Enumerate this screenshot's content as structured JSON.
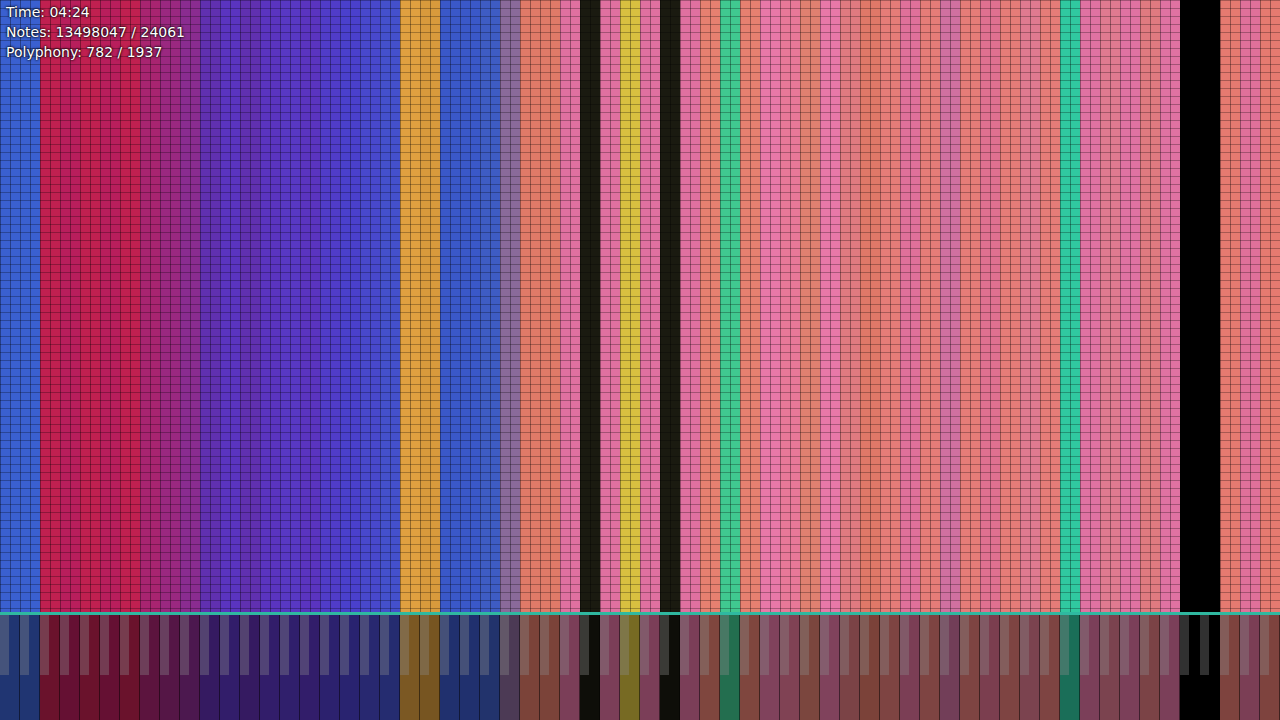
{
  "stats": [
    {
      "label": "Time: 04:24"
    },
    {
      "label": "Notes: 13498047 / 24061"
    },
    {
      "label": "Polyphony: 782 / 1937"
    }
  ],
  "lanes": [
    {
      "color": "#3a60d0"
    },
    {
      "color": "#3a60d0"
    },
    {
      "color": "#c02050"
    },
    {
      "color": "#b81e5c"
    },
    {
      "color": "#c02050"
    },
    {
      "color": "#b81e5c"
    },
    {
      "color": "#c02050"
    },
    {
      "color": "#a82470"
    },
    {
      "color": "#9a2880"
    },
    {
      "color": "#8a2c90"
    },
    {
      "color": "#6030b0"
    },
    {
      "color": "#5a34c0"
    },
    {
      "color": "#6030b0"
    },
    {
      "color": "#5a34c0"
    },
    {
      "color": "#5838c4"
    },
    {
      "color": "#5a34c0"
    },
    {
      "color": "#503cc8"
    },
    {
      "color": "#4a40cc"
    },
    {
      "color": "#4848cc"
    },
    {
      "color": "#4450cc"
    },
    {
      "color": "#e0a040"
    },
    {
      "color": "#d89a3c"
    },
    {
      "color": "#3a58c8"
    },
    {
      "color": "#3a58c8"
    },
    {
      "color": "#3e5cc4"
    },
    {
      "color": "#8a6a9a"
    },
    {
      "color": "#e07a68"
    },
    {
      "color": "#e07a68"
    },
    {
      "color": "#e070a0"
    },
    {
      "color": "#1a1a10"
    },
    {
      "color": "#e070a0"
    },
    {
      "color": "#d8c040"
    },
    {
      "color": "#e070a0"
    },
    {
      "color": "#1a1a10"
    },
    {
      "color": "#e070a0"
    },
    {
      "color": "#e68070"
    },
    {
      "color": "#40c890"
    },
    {
      "color": "#e68070"
    },
    {
      "color": "#e878a8"
    },
    {
      "color": "#e87898"
    },
    {
      "color": "#e08070"
    },
    {
      "color": "#e878a8"
    },
    {
      "color": "#e07a80"
    },
    {
      "color": "#e07868"
    },
    {
      "color": "#e57c78"
    },
    {
      "color": "#e0709a"
    },
    {
      "color": "#e57c78"
    },
    {
      "color": "#d070a0"
    },
    {
      "color": "#e57c78"
    },
    {
      "color": "#e07090"
    },
    {
      "color": "#e57c78"
    },
    {
      "color": "#e07a90"
    },
    {
      "color": "#e57c78"
    },
    {
      "color": "#30c8a0"
    },
    {
      "color": "#e072a2"
    },
    {
      "color": "#e07a90"
    },
    {
      "color": "#e072a2"
    },
    {
      "color": "#e07a80"
    },
    {
      "color": "#e072a2"
    },
    {
      "color": "#000000"
    },
    {
      "color": "#000000"
    },
    {
      "color": "#e57a70"
    },
    {
      "color": "#e0709a"
    },
    {
      "color": "#e57a70"
    }
  ]
}
